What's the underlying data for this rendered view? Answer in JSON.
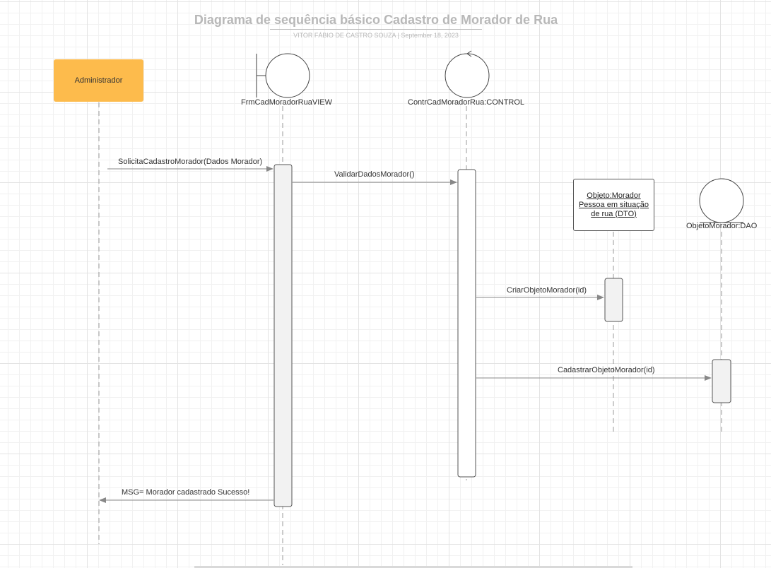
{
  "title": "Diagrama de sequência básico Cadastro de Morador de Rua",
  "subtitle": {
    "author": "VITOR FÁBIO DE CASTRO SOUZA",
    "separator": "|",
    "date": "September 18, 2023"
  },
  "participants": {
    "actor": "Administrador",
    "view": "FrmCadMoradorRuaVIEW",
    "control": "ContrCadMoradorRua:CONTROL",
    "entity": {
      "line1": "Objeto:Morador",
      "line2": "Pessoa em situação",
      "line3": "de rua (DTO)"
    },
    "dao": "ObjetoMorador:DAO"
  },
  "messages": {
    "m1": "SolicitaCadastroMorador(Dados Morador)",
    "m2": "ValidarDadosMorador()",
    "m3": "CriarObjetoMorador(id)",
    "m4": "CadastrarObjetoMorador(id)",
    "m5": "MSG= Morador cadastrado Sucesso!"
  },
  "colors": {
    "actor_fill": "#fdbb4c",
    "grid": "#e3e3e3",
    "title": "#b8b8b8"
  }
}
